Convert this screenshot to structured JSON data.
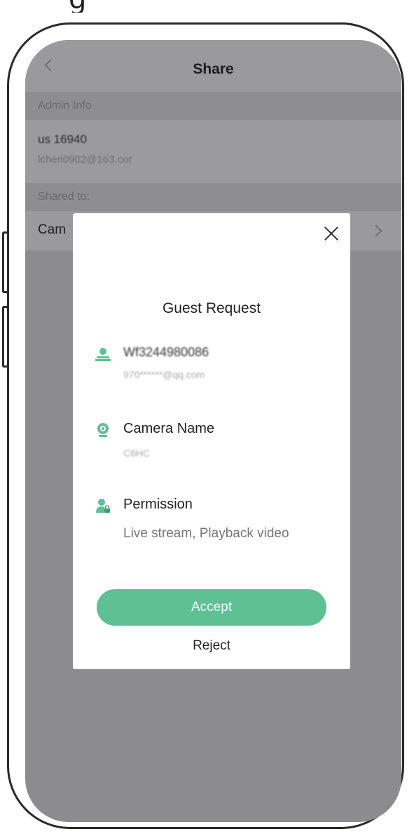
{
  "header": {
    "title": "Share"
  },
  "admin": {
    "section_label": "Admin Info",
    "name": "us 16940",
    "email": "lchen0902@163.cor"
  },
  "shared": {
    "section_label": "Shared to:",
    "camera_label": "Cam"
  },
  "modal": {
    "title": "Guest Request",
    "guest": {
      "name": "Wf3244980086",
      "email": "970******@qq.com"
    },
    "camera": {
      "label": "Camera Name",
      "value": "C6HC"
    },
    "permission": {
      "label": "Permission",
      "value": "Live stream, Playback video"
    },
    "accept_label": "Accept",
    "reject_label": "Reject"
  },
  "colors": {
    "accent": "#5fc094",
    "overlay": "#8c8c8f"
  },
  "icons": [
    "back-icon",
    "chevron-right-icon",
    "close-icon",
    "person-icon",
    "camera-icon",
    "person-lock-icon"
  ]
}
